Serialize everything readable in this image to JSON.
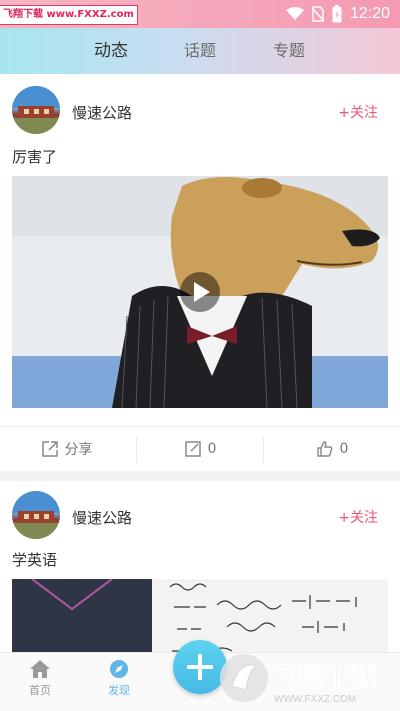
{
  "status_bar": {
    "watermark": "飞翔下载 www.FXXZ.com",
    "time": "12:20"
  },
  "top_tabs": [
    {
      "label": "动态",
      "active": true
    },
    {
      "label": "话题",
      "active": false
    },
    {
      "label": "专题",
      "active": false
    }
  ],
  "posts": [
    {
      "username": "慢速公路",
      "follow_label": "+关注",
      "text": "厉害了",
      "share_label": "分享",
      "comment_count": "0",
      "like_count": "0",
      "media": "video"
    },
    {
      "username": "慢速公路",
      "follow_label": "+关注",
      "text": "学英语",
      "media": "image"
    }
  ],
  "bottom_nav": [
    {
      "label": "首页",
      "icon": "home-icon",
      "active": false
    },
    {
      "label": "发现",
      "icon": "compass-icon",
      "active": true
    }
  ],
  "fab_icon": "plus-icon",
  "logo_watermark": {
    "text": "飞翔下载",
    "url": "WWW.FXXZ.COM"
  },
  "colors": {
    "accent": "#5fb6e8",
    "follow": "#e8566f"
  }
}
